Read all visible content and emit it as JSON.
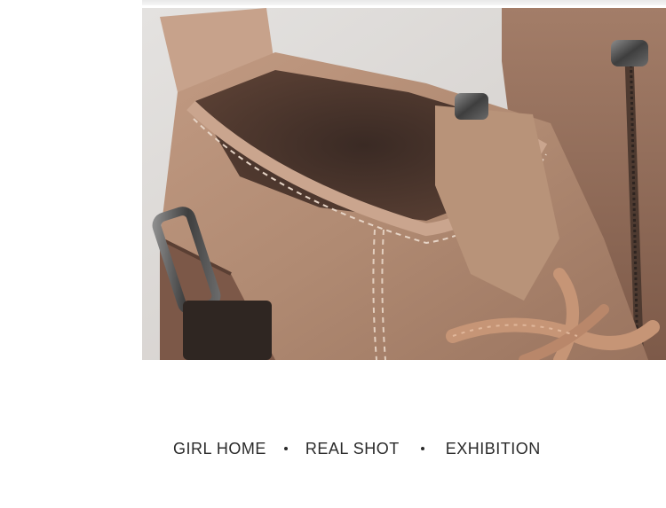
{
  "photo": {
    "alt": "Close-up of a tan suede ankle boot with lace and buckle"
  },
  "caption": {
    "part1": "GIRL HOME",
    "part2": "REAL SHOT",
    "part3": "EXHIBITION"
  },
  "colors": {
    "suede": "#b08a72",
    "suede_dark": "#8a6452",
    "background": "#ffffff",
    "text": "#2a2a2a"
  }
}
